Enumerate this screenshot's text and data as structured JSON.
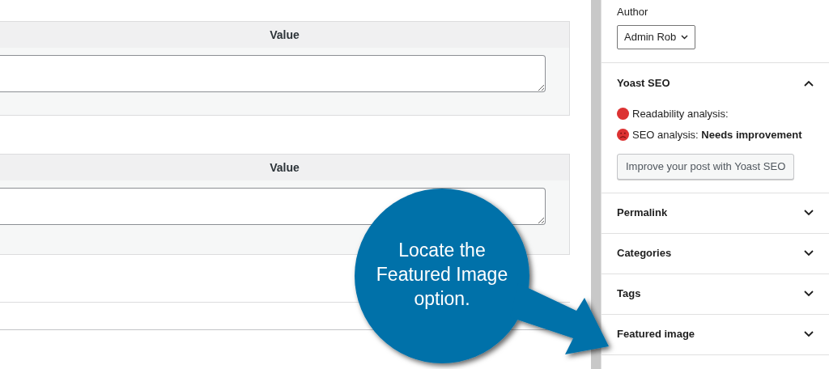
{
  "value_panels": [
    {
      "header": "Value"
    },
    {
      "header": "Value"
    }
  ],
  "sidebar": {
    "author": {
      "label": "Author",
      "value": "Admin Rob"
    },
    "yoast": {
      "title": "Yoast SEO",
      "expanded": true,
      "analyses": [
        {
          "kind": "dot",
          "label": "Readability analysis:"
        },
        {
          "kind": "face",
          "label": "SEO analysis:",
          "result": "Needs improvement"
        }
      ],
      "button": "Improve your post with Yoast SEO"
    },
    "panels": [
      {
        "title": "Permalink",
        "expanded": false
      },
      {
        "title": "Categories",
        "expanded": false
      },
      {
        "title": "Tags",
        "expanded": false
      },
      {
        "title": "Featured image",
        "expanded": false
      }
    ]
  },
  "callout": {
    "lines": [
      "Locate the",
      "Featured Image",
      "option."
    ]
  }
}
